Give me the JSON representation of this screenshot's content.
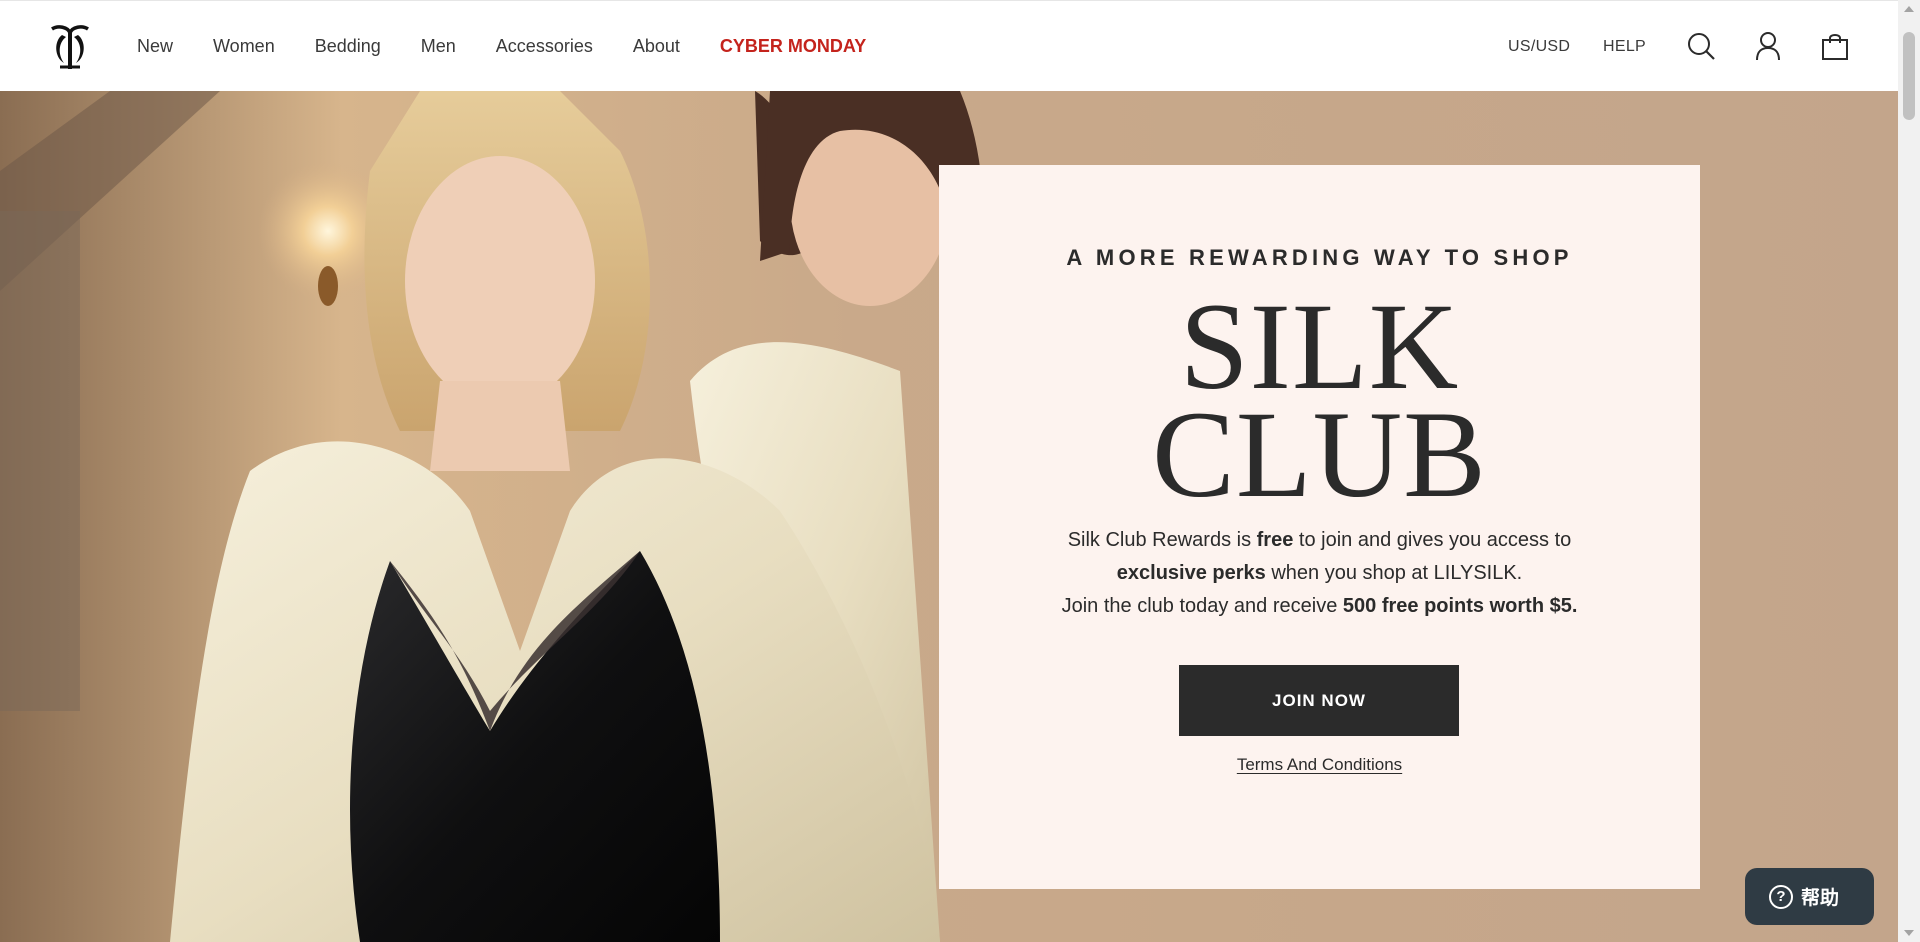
{
  "header": {
    "logo_icon": "lilysilk-monogram-icon",
    "nav": [
      {
        "label": "New"
      },
      {
        "label": "Women"
      },
      {
        "label": "Bedding"
      },
      {
        "label": "Men"
      },
      {
        "label": "Accessories"
      },
      {
        "label": "About"
      },
      {
        "label": "CYBER MONDAY",
        "color": "#c4231c"
      }
    ],
    "region": "US/USD",
    "help": "HELP",
    "icons": [
      "search-icon",
      "account-icon",
      "shopping-bag-icon"
    ]
  },
  "hero": {
    "eyebrow": "A MORE REWARDING WAY TO SHOP",
    "title_line1": "SILK",
    "title_line2": "CLUB",
    "copy": {
      "p1_a": "Silk Club Rewards is ",
      "p1_b": "free",
      "p1_c": " to join and gives you access to",
      "p2_a": "exclusive perks",
      "p2_b": " when you shop at LILYSILK.",
      "p3_a": "Join the club today and receive ",
      "p3_b": "500 free points worth $5."
    },
    "cta": "JOIN NOW",
    "terms": "Terms And Conditions",
    "card_color": "#fdf3ef",
    "button_color": "#2b2b2b"
  },
  "help_widget": {
    "label": "帮助",
    "icon": "question-circle-icon"
  }
}
